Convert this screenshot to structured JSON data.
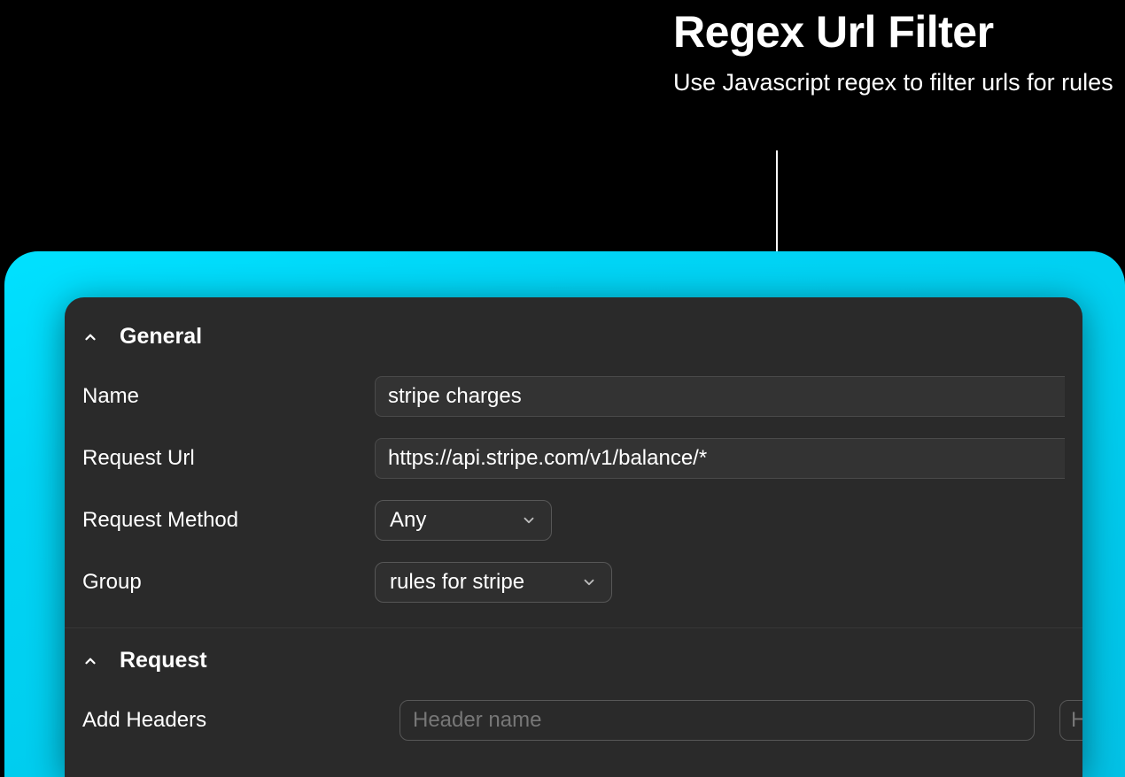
{
  "hero": {
    "title": "Regex Url Filter",
    "subtitle": "Use Javascript regex to filter urls for rules"
  },
  "sections": {
    "general": {
      "title": "General",
      "fields": {
        "name_label": "Name",
        "name_value": "stripe charges",
        "url_label": "Request Url",
        "url_value": "https://api.stripe.com/v1/balance/*",
        "method_label": "Request Method",
        "method_value": "Any",
        "group_label": "Group",
        "group_value": "rules for stripe"
      }
    },
    "request": {
      "title": "Request",
      "fields": {
        "add_headers_label": "Add Headers",
        "header_name_placeholder": "Header name",
        "header_value_preview": "He"
      }
    }
  }
}
